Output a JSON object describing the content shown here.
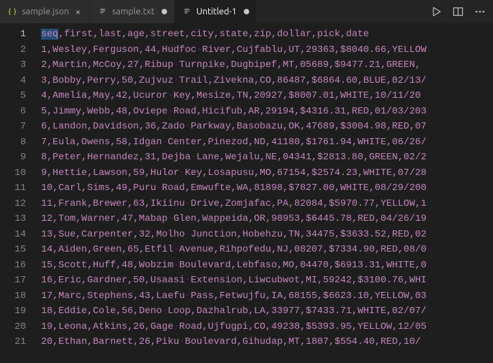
{
  "tabs": [
    {
      "label": "sample.json",
      "icon": "json",
      "dirty": false,
      "active": false
    },
    {
      "label": "sample.txt",
      "icon": "file",
      "dirty": true,
      "active": false
    },
    {
      "label": "Untitled-1",
      "icon": "file",
      "dirty": true,
      "active": true
    }
  ],
  "actions": {
    "run": "run-icon",
    "split": "split-editor-icon",
    "more": "more-icon"
  },
  "editor": {
    "current_line": 1,
    "selection": "seq",
    "whitespace_glyph": "·",
    "lines": [
      "seq,first,last,age,street,city,state,zip,dollar,pick,date",
      "1,Wesley,Ferguson,44,Hudfoc River,Cujfablu,UT,29363,$8040.66,YELLOW",
      "2,Martin,McCoy,27,Ribup Turnpike,Dugbipef,MT,05689,$9477.21,GREEN,",
      "3,Bobby,Perry,50,Zujvuz Trail,Zivekna,CO,86487,$6864.60,BLUE,02/13/",
      "4,Amelia,May,42,Ucuror Key,Mesize,TN,20927,$8007.01,WHITE,10/11/20",
      "5,Jimmy,Webb,48,Oviepe Road,Hicifub,AR,29194,$4316.31,RED,01/03/203",
      "6,Landon,Davidson,36,Zado Parkway,Basobazu,OK,47689,$3004.98,RED,07",
      "7,Eula,Owens,58,Idgan Center,Pinezod,ND,41180,$1761.94,WHITE,06/26/",
      "8,Peter,Hernandez,31,Dejba Lane,Wejalu,NE,04341,$2813.80,GREEN,02/2",
      "9,Hettie,Lawson,59,Hulor Key,Losapusu,MO,67154,$2574.23,WHITE,07/28",
      "10,Carl,Sims,49,Puru Road,Emwufte,WA,81898,$7827.00,WHITE,08/29/200",
      "11,Frank,Brewer,63,Ikiinu Drive,Zomjafac,PA,82084,$5970.77,YELLOW,1",
      "12,Tom,Warner,47,Mabap Glen,Wappeida,OR,98953,$6445.78,RED,04/26/19",
      "13,Sue,Carpenter,32,Molho Junction,Hobehzu,TN,34475,$3633.52,RED,02",
      "14,Aiden,Green,65,Etfil Avenue,Rihpofedu,NJ,08207,$7334.90,RED,08/0",
      "15,Scott,Huff,48,Wobzim Boulevard,Lebfaso,MO,04470,$6913.31,WHITE,0",
      "16,Eric,Gardner,50,Usaasi Extension,Liwcubwot,MI,59242,$3100.76,WHI",
      "17,Marc,Stephens,43,Laefu Pass,Fetwujfu,IA,68155,$6623.10,YELLOW,03",
      "18,Eddie,Cole,56,Deno Loop,Dazhalrub,LA,33977,$7433.71,WHITE,02/07/",
      "19,Leona,Atkins,26,Gage Road,Ujfugpi,CO,49238,$5393.95,YELLOW,12/05",
      "20,Ethan,Barnett,26,Piku Boulevard,Gihudap,MT,1807,$554.40,RED,10/"
    ]
  },
  "chart_data": {
    "type": "table",
    "columns": [
      "seq",
      "first",
      "last",
      "age",
      "street",
      "city",
      "state",
      "zip",
      "dollar",
      "pick",
      "date"
    ],
    "rows": [
      {
        "seq": 1,
        "first": "Wesley",
        "last": "Ferguson",
        "age": 44,
        "street": "Hudfoc River",
        "city": "Cujfablu",
        "state": "UT",
        "zip": "29363",
        "dollar": "$8040.66",
        "pick": "YELLOW",
        "date": null
      },
      {
        "seq": 2,
        "first": "Martin",
        "last": "McCoy",
        "age": 27,
        "street": "Ribup Turnpike",
        "city": "Dugbipef",
        "state": "MT",
        "zip": "05689",
        "dollar": "$9477.21",
        "pick": "GREEN",
        "date": null
      },
      {
        "seq": 3,
        "first": "Bobby",
        "last": "Perry",
        "age": 50,
        "street": "Zujvuz Trail",
        "city": "Zivekna",
        "state": "CO",
        "zip": "86487",
        "dollar": "$6864.60",
        "pick": "BLUE",
        "date": "02/13/"
      },
      {
        "seq": 4,
        "first": "Amelia",
        "last": "May",
        "age": 42,
        "street": "Ucuror Key",
        "city": "Mesize",
        "state": "TN",
        "zip": "20927",
        "dollar": "$8007.01",
        "pick": "WHITE",
        "date": "10/11/20"
      },
      {
        "seq": 5,
        "first": "Jimmy",
        "last": "Webb",
        "age": 48,
        "street": "Oviepe Road",
        "city": "Hicifub",
        "state": "AR",
        "zip": "29194",
        "dollar": "$4316.31",
        "pick": "RED",
        "date": "01/03/203"
      },
      {
        "seq": 6,
        "first": "Landon",
        "last": "Davidson",
        "age": 36,
        "street": "Zado Parkway",
        "city": "Basobazu",
        "state": "OK",
        "zip": "47689",
        "dollar": "$3004.98",
        "pick": "RED",
        "date": "07"
      },
      {
        "seq": 7,
        "first": "Eula",
        "last": "Owens",
        "age": 58,
        "street": "Idgan Center",
        "city": "Pinezod",
        "state": "ND",
        "zip": "41180",
        "dollar": "$1761.94",
        "pick": "WHITE",
        "date": "06/26/"
      },
      {
        "seq": 8,
        "first": "Peter",
        "last": "Hernandez",
        "age": 31,
        "street": "Dejba Lane",
        "city": "Wejalu",
        "state": "NE",
        "zip": "04341",
        "dollar": "$2813.80",
        "pick": "GREEN",
        "date": "02/2"
      },
      {
        "seq": 9,
        "first": "Hettie",
        "last": "Lawson",
        "age": 59,
        "street": "Hulor Key",
        "city": "Losapusu",
        "state": "MO",
        "zip": "67154",
        "dollar": "$2574.23",
        "pick": "WHITE",
        "date": "07/28"
      },
      {
        "seq": 10,
        "first": "Carl",
        "last": "Sims",
        "age": 49,
        "street": "Puru Road",
        "city": "Emwufte",
        "state": "WA",
        "zip": "81898",
        "dollar": "$7827.00",
        "pick": "WHITE",
        "date": "08/29/200"
      },
      {
        "seq": 11,
        "first": "Frank",
        "last": "Brewer",
        "age": 63,
        "street": "Ikiinu Drive",
        "city": "Zomjafac",
        "state": "PA",
        "zip": "82084",
        "dollar": "$5970.77",
        "pick": "YELLOW",
        "date": "1"
      },
      {
        "seq": 12,
        "first": "Tom",
        "last": "Warner",
        "age": 47,
        "street": "Mabap Glen",
        "city": "Wappeida",
        "state": "OR",
        "zip": "98953",
        "dollar": "$6445.78",
        "pick": "RED",
        "date": "04/26/19"
      },
      {
        "seq": 13,
        "first": "Sue",
        "last": "Carpenter",
        "age": 32,
        "street": "Molho Junction",
        "city": "Hobehzu",
        "state": "TN",
        "zip": "34475",
        "dollar": "$3633.52",
        "pick": "RED",
        "date": "02"
      },
      {
        "seq": 14,
        "first": "Aiden",
        "last": "Green",
        "age": 65,
        "street": "Etfil Avenue",
        "city": "Rihpofedu",
        "state": "NJ",
        "zip": "08207",
        "dollar": "$7334.90",
        "pick": "RED",
        "date": "08/0"
      },
      {
        "seq": 15,
        "first": "Scott",
        "last": "Huff",
        "age": 48,
        "street": "Wobzim Boulevard",
        "city": "Lebfaso",
        "state": "MO",
        "zip": "04470",
        "dollar": "$6913.31",
        "pick": "WHITE",
        "date": "0"
      },
      {
        "seq": 16,
        "first": "Eric",
        "last": "Gardner",
        "age": 50,
        "street": "Usaasi Extension",
        "city": "Liwcubwot",
        "state": "MI",
        "zip": "59242",
        "dollar": "$3100.76",
        "pick": "WHI",
        "date": null
      },
      {
        "seq": 17,
        "first": "Marc",
        "last": "Stephens",
        "age": 43,
        "street": "Laefu Pass",
        "city": "Fetwujfu",
        "state": "IA",
        "zip": "68155",
        "dollar": "$6623.10",
        "pick": "YELLOW",
        "date": "03"
      },
      {
        "seq": 18,
        "first": "Eddie",
        "last": "Cole",
        "age": 56,
        "street": "Deno Loop",
        "city": "Dazhalrub",
        "state": "LA",
        "zip": "33977",
        "dollar": "$7433.71",
        "pick": "WHITE",
        "date": "02/07/"
      },
      {
        "seq": 19,
        "first": "Leona",
        "last": "Atkins",
        "age": 26,
        "street": "Gage Road",
        "city": "Ujfugpi",
        "state": "CO",
        "zip": "49238",
        "dollar": "$5393.95",
        "pick": "YELLOW",
        "date": "12/05"
      },
      {
        "seq": 20,
        "first": "Ethan",
        "last": "Barnett",
        "age": 26,
        "street": "Piku Boulevard",
        "city": "Gihudap",
        "state": "MT",
        "zip": "1807",
        "dollar": "$554.40",
        "pick": "RED",
        "date": "10/"
      }
    ]
  }
}
